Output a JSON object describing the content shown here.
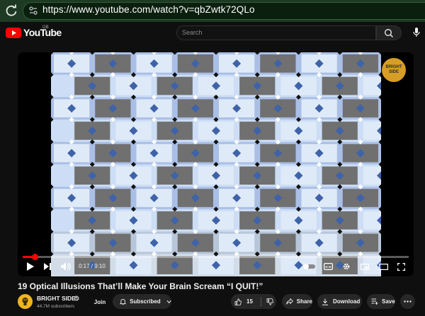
{
  "browser": {
    "url": "https://www.youtube.com/watch?v=qbZwtk72QLo"
  },
  "header": {
    "brand": "YouTube",
    "region": "GB",
    "search_placeholder": "Search"
  },
  "player": {
    "watermark_line1": "BRIGHT",
    "watermark_line2": "SIDE",
    "current_time": "0:17",
    "duration": "9:10",
    "time_display": "0:17 / 9:10",
    "progress_fraction": 0.031
  },
  "video": {
    "title": "19 Optical Illusions That’ll Make Your Brain Scream “I QUIT!”"
  },
  "channel": {
    "name": "BRIGHT SIDE",
    "subscribers": "44.7M subscribers",
    "join_label": "Join",
    "subscribed_label": "Subscribed"
  },
  "actions": {
    "likes": "15",
    "share_label": "Share",
    "download_label": "Download",
    "save_label": "Save"
  },
  "colors": {
    "accent": "#ff0000",
    "brand_yellow": "#f0b41c"
  }
}
